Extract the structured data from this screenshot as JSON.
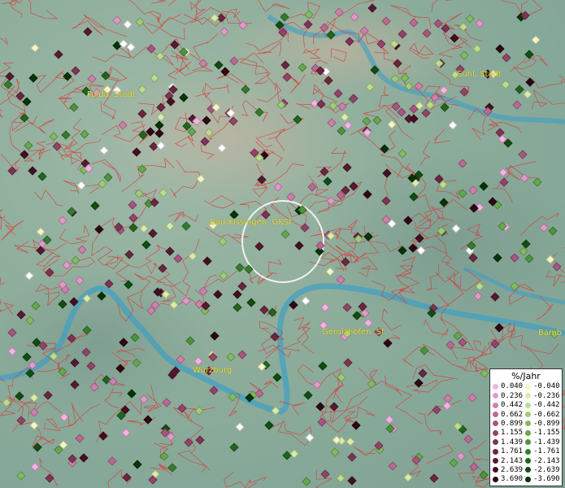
{
  "cities": [
    {
      "name": "Fulda, Stadt"
    },
    {
      "name": "Suhl, Stadt"
    },
    {
      "name": "Bad Kissingen, GKSt"
    },
    {
      "name": "Gerolzhofen, St"
    },
    {
      "name": "Würzburg"
    },
    {
      "name": "Bamb"
    }
  ],
  "legend": {
    "title": "%/Jahr",
    "positive": [
      {
        "value": "0.040",
        "color": "#f3b3e3"
      },
      {
        "value": "0.236",
        "color": "#e29ac8"
      },
      {
        "value": "0.442",
        "color": "#cf80ad"
      },
      {
        "value": "0.662",
        "color": "#bb6a94"
      },
      {
        "value": "0.899",
        "color": "#a7567e"
      },
      {
        "value": "1.155",
        "color": "#934468"
      },
      {
        "value": "1.439",
        "color": "#7f3453"
      },
      {
        "value": "1.761",
        "color": "#6b2640"
      },
      {
        "value": "2.143",
        "color": "#571a30"
      },
      {
        "value": "2.639",
        "color": "#431021"
      },
      {
        "value": "3.690",
        "color": "#2e0714"
      }
    ],
    "negative": [
      {
        "value": "-0.040",
        "color": "#f3f7c6"
      },
      {
        "value": "-0.236",
        "color": "#d9ecaa"
      },
      {
        "value": "-0.442",
        "color": "#bcdd8f"
      },
      {
        "value": "-0.662",
        "color": "#9fcd78"
      },
      {
        "value": "-0.899",
        "color": "#82bb63"
      },
      {
        "value": "-1.155",
        "color": "#66a84f"
      },
      {
        "value": "-1.439",
        "color": "#4c943d"
      },
      {
        "value": "-1.761",
        "color": "#357d2d"
      },
      {
        "value": "-2.143",
        "color": "#21661f"
      },
      {
        "value": "-2.639",
        "color": "#114e13"
      },
      {
        "value": "-3.690",
        "color": "#053408"
      }
    ]
  }
}
